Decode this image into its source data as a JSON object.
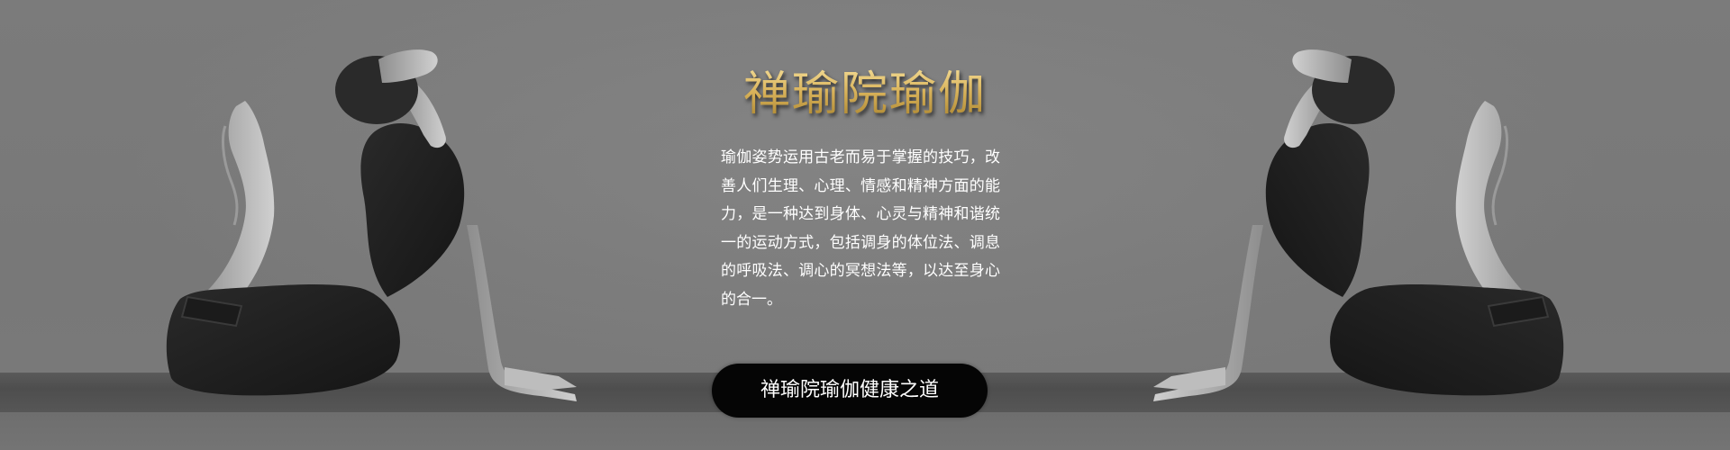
{
  "banner": {
    "title": "禅瑜院瑜伽",
    "description": "瑜伽姿势运用古老而易于掌握的技巧，改善人们生理、心理、情感和精神方面的能力，是一种达到身体、心灵与精神和谐统一的运动方式，包括调身的体位法、调息的呼吸法、调心的冥想法等，以达至身心的合一。",
    "cta_label": "禅瑜院瑜伽健康之道"
  },
  "colors": {
    "background": "#787878",
    "title_gold": "#d8b45f",
    "button_bg": "#050505",
    "text": "#ffffff"
  }
}
